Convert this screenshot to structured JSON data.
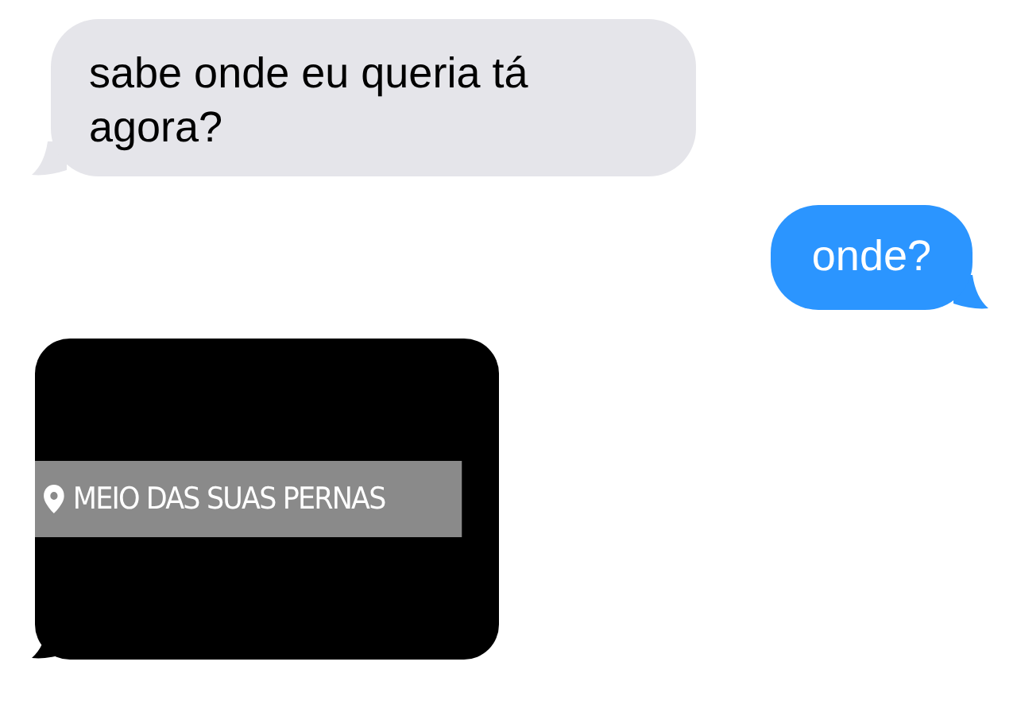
{
  "messages": [
    {
      "kind": "text",
      "sent": false,
      "text": "sabe onde eu queria tá agora?"
    },
    {
      "kind": "text",
      "sent": true,
      "text": "onde?"
    },
    {
      "kind": "sticker",
      "sent": false,
      "text": "MEIO DAS SUAS PERNAS"
    }
  ]
}
